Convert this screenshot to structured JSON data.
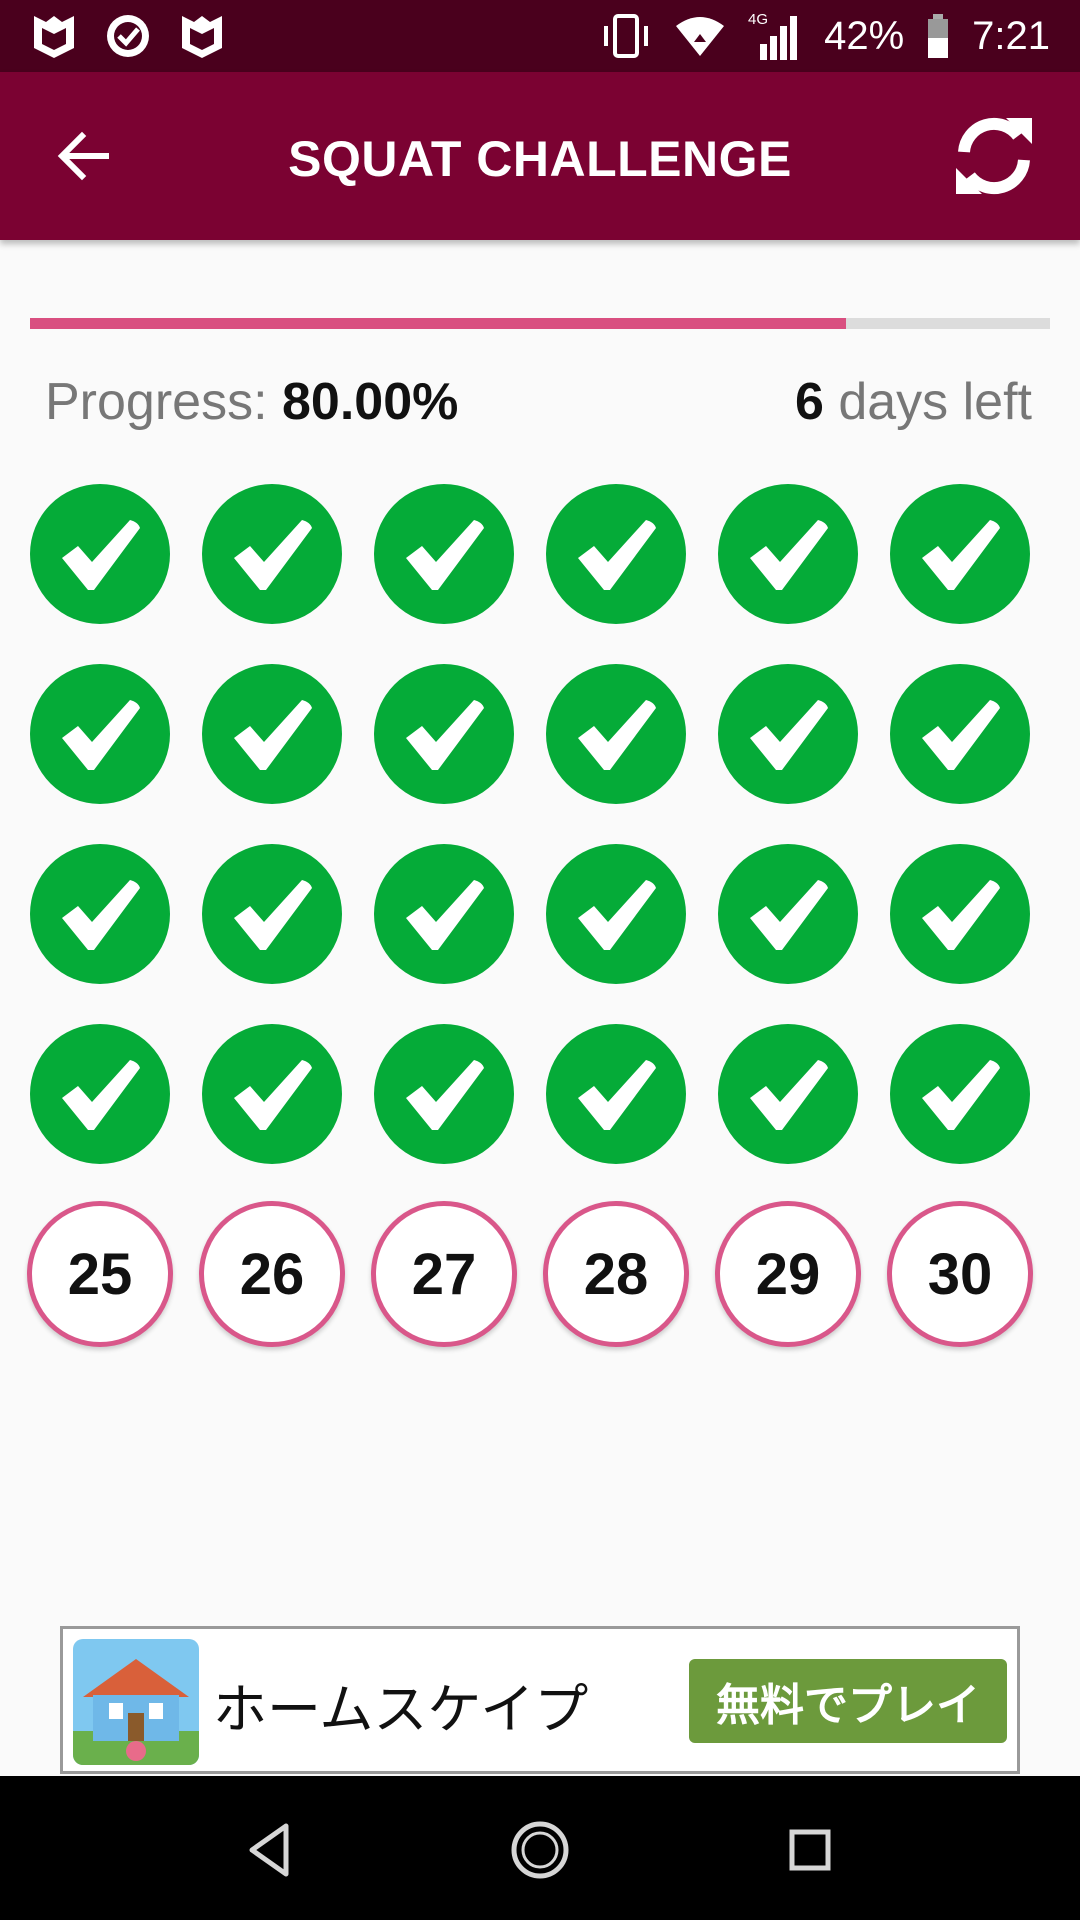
{
  "status_bar": {
    "battery": "42%",
    "time": "7:21",
    "network": "4G",
    "left_icons": [
      "mcafee-icon",
      "check-badge-icon",
      "mcafee-icon"
    ]
  },
  "app_bar": {
    "title": "SQUAT CHALLENGE"
  },
  "progress": {
    "label": "Progress: ",
    "value": "80.00%",
    "fraction": 0.8,
    "days_left_value": "6",
    "days_left_label": " days left"
  },
  "days": {
    "completed_count": 24,
    "remaining": [
      "25",
      "26",
      "27",
      "28",
      "29",
      "30"
    ]
  },
  "ad": {
    "title": "ホームスケイプ",
    "cta": "無料でプレイ"
  },
  "colors": {
    "status_bar": "#4a001d",
    "app_bar": "#7b0232",
    "accent": "#d94f80",
    "done": "#05ab38",
    "ad_cta": "#6c9a3c"
  }
}
